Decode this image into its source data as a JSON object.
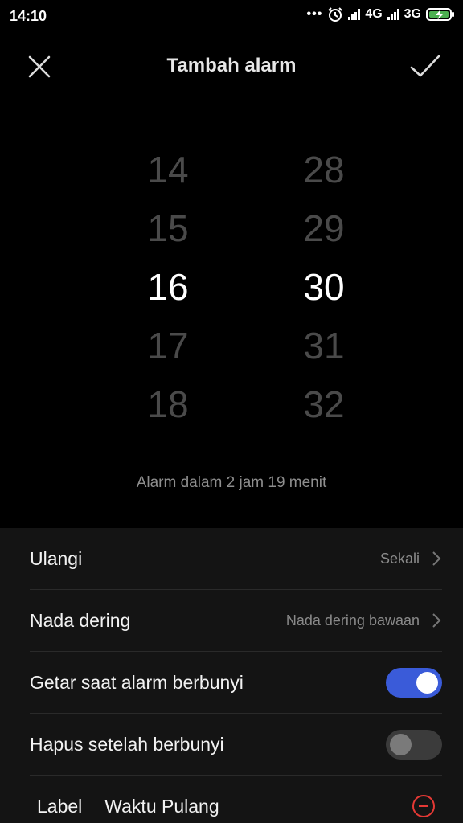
{
  "status": {
    "time": "14:10",
    "dots": "•••",
    "net1": "4G",
    "net2": "3G"
  },
  "header": {
    "title": "Tambah alarm"
  },
  "picker": {
    "hours": [
      "14",
      "15",
      "16",
      "17",
      "18"
    ],
    "minutes": [
      "28",
      "29",
      "30",
      "31",
      "32"
    ],
    "selected_hour": "16",
    "selected_minute": "30"
  },
  "hint": "Alarm dalam 2 jam 19 menit",
  "settings": {
    "repeat": {
      "label": "Ulangi",
      "value": "Sekali"
    },
    "ringtone": {
      "label": "Nada dering",
      "value": "Nada dering bawaan"
    },
    "vibrate": {
      "label": "Getar saat alarm berbunyi",
      "on": true
    },
    "delete_after": {
      "label": "Hapus setelah berbunyi",
      "on": false
    },
    "label": {
      "key": "Label",
      "value": "Waktu Pulang"
    }
  },
  "colors": {
    "accent": "#3a5bd9",
    "clear_icon": "#e53935",
    "background": "#000000",
    "panel": "#141414"
  },
  "icons": {
    "close": "close-icon",
    "confirm": "check-icon",
    "chevron": "chevron-right-icon",
    "clear": "minus-circle-icon",
    "alarm": "alarm-clock-icon",
    "battery": "battery-charging-icon"
  }
}
